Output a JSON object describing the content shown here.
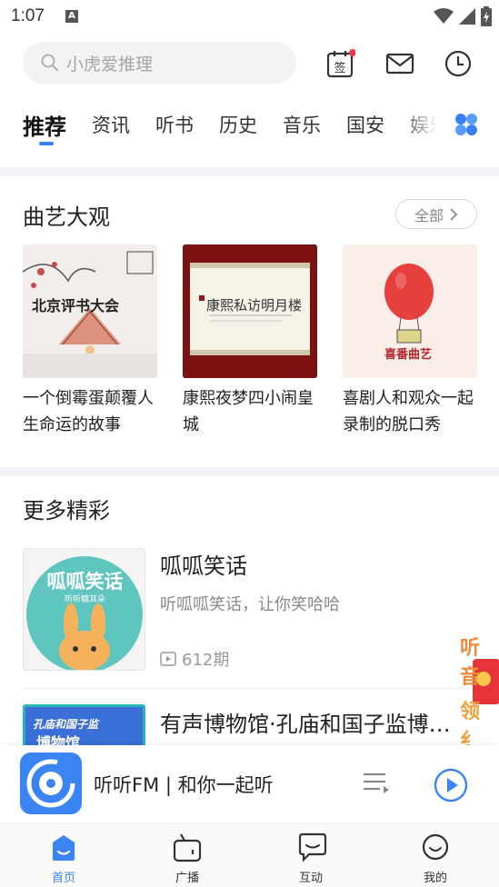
{
  "status": {
    "time": "1:07"
  },
  "search": {
    "placeholder": "小虎爱推理"
  },
  "header_icons": {
    "checkin_label": "签"
  },
  "tabs": [
    {
      "label": "推荐",
      "active": true
    },
    {
      "label": "资讯"
    },
    {
      "label": "听书"
    },
    {
      "label": "历史"
    },
    {
      "label": "音乐"
    },
    {
      "label": "国安"
    },
    {
      "label": "娱乐"
    }
  ],
  "quyi": {
    "title": "曲艺大观",
    "all_label": "全部",
    "cards": [
      {
        "title": "一个倒霉蛋颠覆人生命运的故事",
        "cover_text": "北京评书大会"
      },
      {
        "title": "康熙夜梦四小闹皇城",
        "cover_text": "康熙私访明月楼"
      },
      {
        "title": "喜剧人和观众一起录制的脱口秀",
        "cover_text": "喜番曲艺"
      }
    ]
  },
  "more": {
    "title": "更多精彩",
    "items": [
      {
        "title": "呱呱笑话",
        "desc": "听呱呱笑话，让你笑哈哈",
        "count": "612期",
        "cover_text": "呱呱笑话",
        "cover_sub": "听听糖耳朵"
      },
      {
        "title": "有声博物馆·孔庙和国子监博…",
        "cover_text": "孔庙和国子监",
        "cover_sub": "博物馆"
      }
    ]
  },
  "player": {
    "title": "听听FM | 和你一起听"
  },
  "promo": {
    "text_top": "听音",
    "text_bottom": "领纟"
  },
  "nav": [
    {
      "label": "首页",
      "active": true
    },
    {
      "label": "广播"
    },
    {
      "label": "互动"
    },
    {
      "label": "我的"
    }
  ],
  "colors": {
    "accent": "#3a7ff6",
    "active_nav": "#3a85f3"
  }
}
